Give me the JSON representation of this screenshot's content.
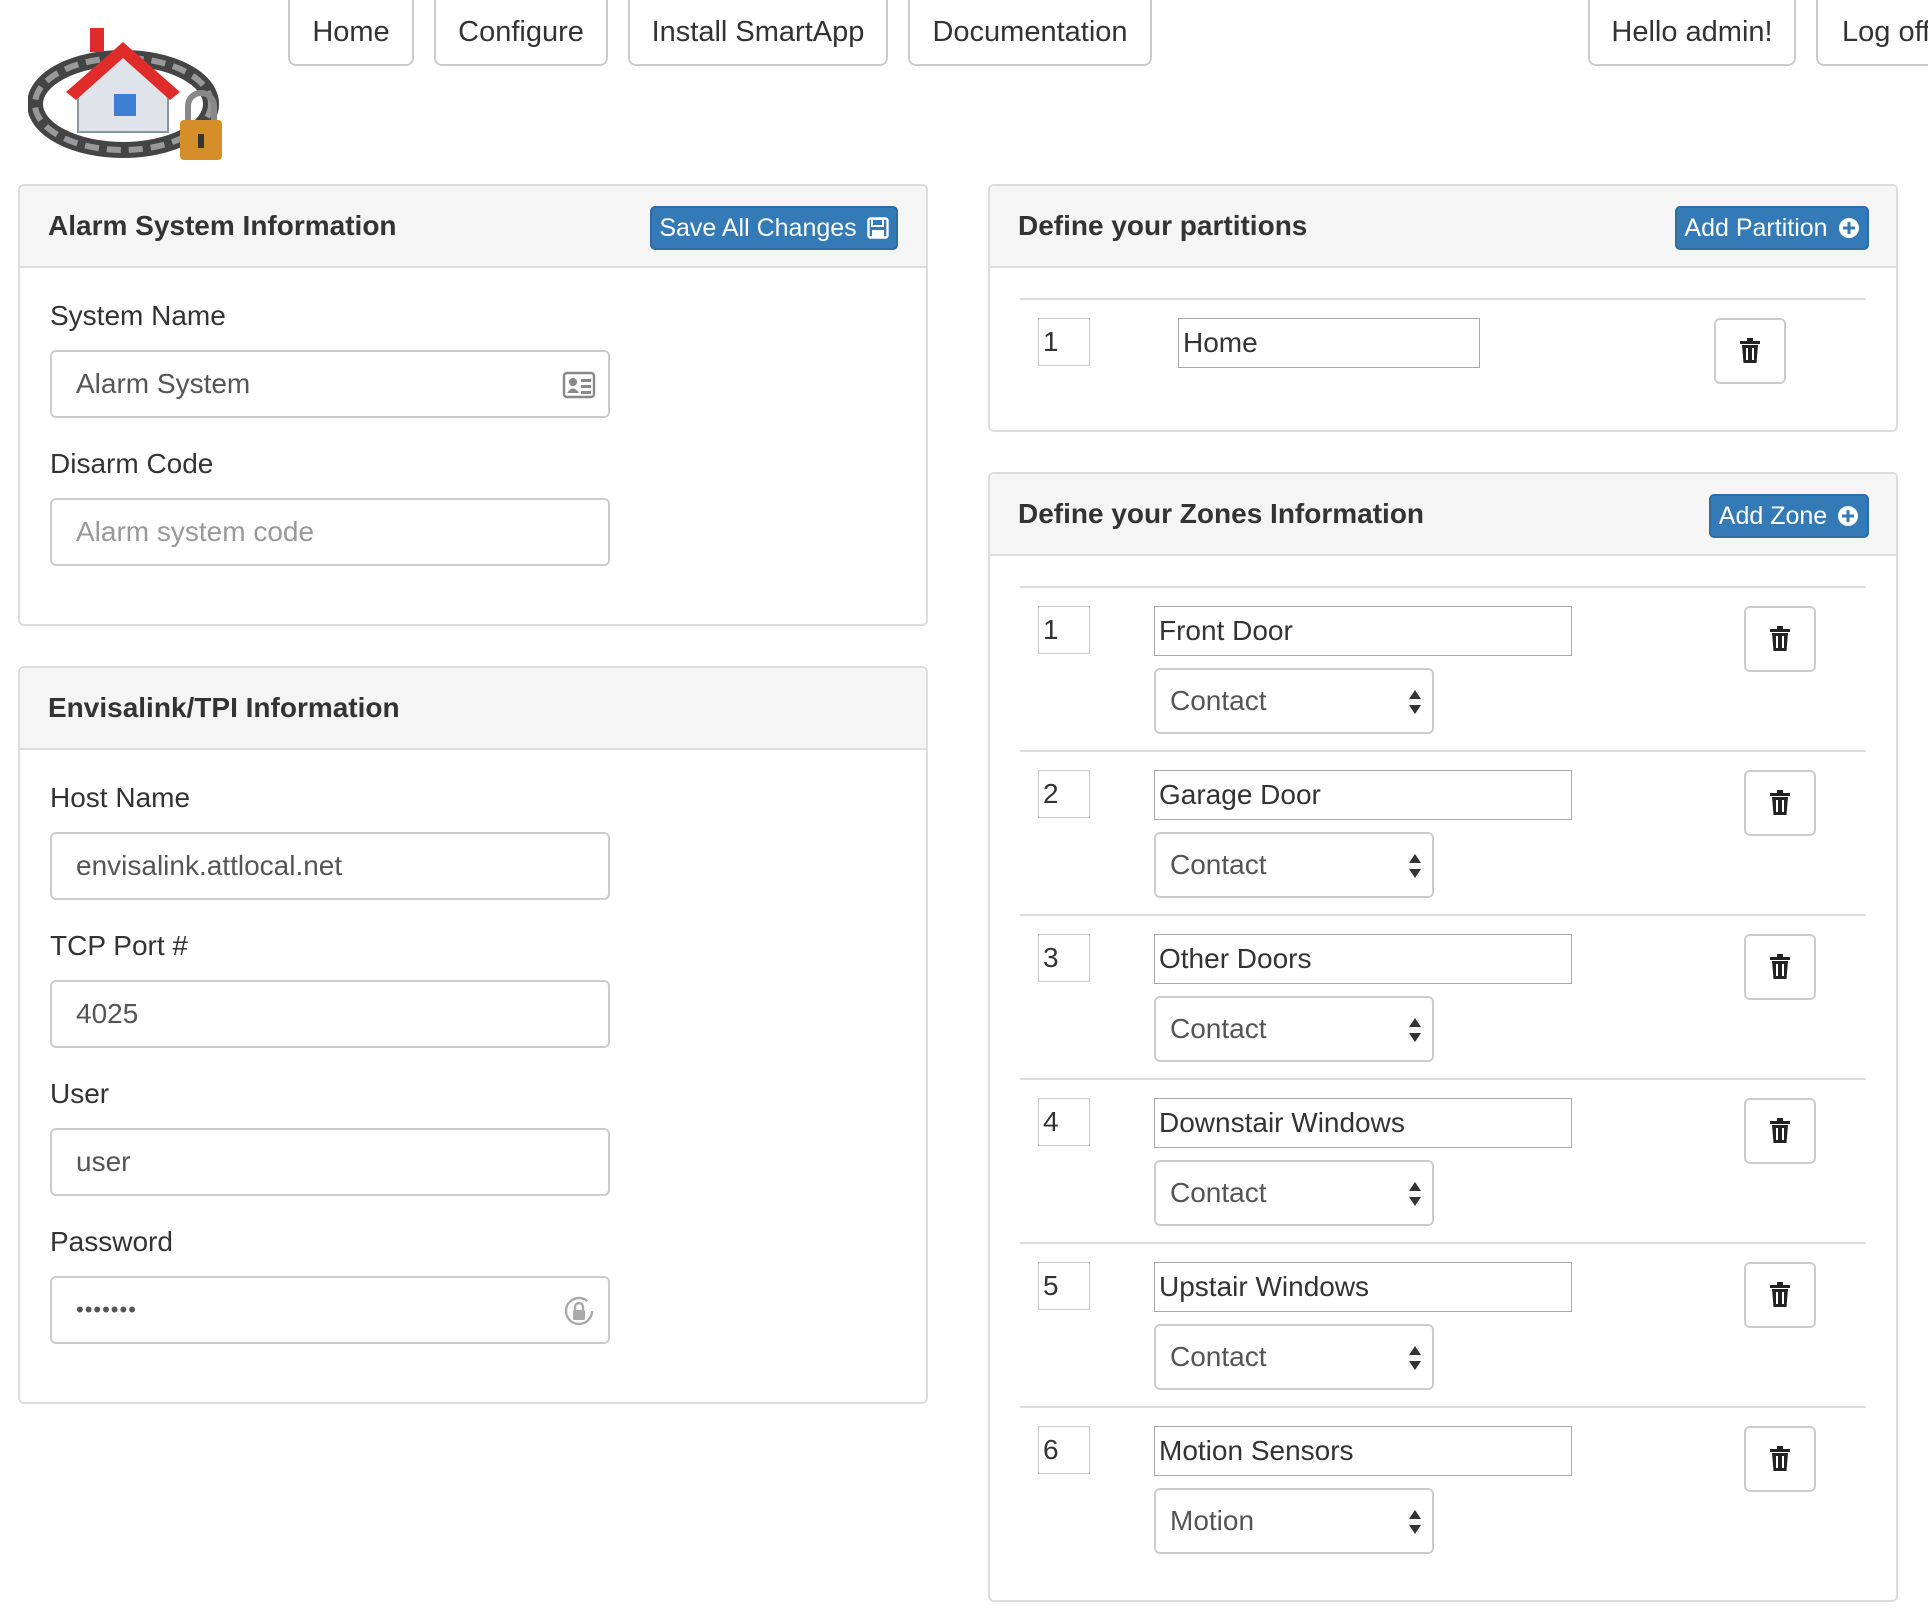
{
  "nav": {
    "home": "Home",
    "configure": "Configure",
    "install": "Install SmartApp",
    "docs": "Documentation",
    "hello": "Hello admin!",
    "logoff": "Log off"
  },
  "alarm_panel": {
    "title": "Alarm System Information",
    "save_label": "Save All Changes",
    "system_name_label": "System Name",
    "system_name_value": "Alarm System",
    "disarm_label": "Disarm Code",
    "disarm_placeholder": "Alarm system code"
  },
  "tpi_panel": {
    "title": "Envisalink/TPI Information",
    "host_label": "Host Name",
    "host_value": "envisalink.attlocal.net",
    "port_label": "TCP Port #",
    "port_value": "4025",
    "user_label": "User",
    "user_value": "user",
    "password_label": "Password",
    "password_value": "•••••••"
  },
  "partitions_panel": {
    "title": "Define your partitions",
    "add_label": "Add Partition",
    "items": [
      {
        "number": "1",
        "name": "Home"
      }
    ]
  },
  "zones_panel": {
    "title": "Define your Zones Information",
    "add_label": "Add Zone",
    "items": [
      {
        "number": "1",
        "name": "Front Door",
        "type": "Contact"
      },
      {
        "number": "2",
        "name": "Garage Door",
        "type": "Contact"
      },
      {
        "number": "3",
        "name": "Other Doors",
        "type": "Contact"
      },
      {
        "number": "4",
        "name": "Downstair Windows",
        "type": "Contact"
      },
      {
        "number": "5",
        "name": "Upstair Windows",
        "type": "Contact"
      },
      {
        "number": "6",
        "name": "Motion Sensors",
        "type": "Motion"
      }
    ]
  },
  "icons": {
    "logo": "house-chain-lock-logo",
    "save": "floppy-disk-icon",
    "add": "plus-circle-icon",
    "trash": "trash-icon",
    "contact_card": "contact-card-icon",
    "password_key": "password-key-icon"
  },
  "colors": {
    "primary": "#337ab7",
    "panel_heading_bg": "#f5f5f5",
    "border": "#dddddd"
  }
}
